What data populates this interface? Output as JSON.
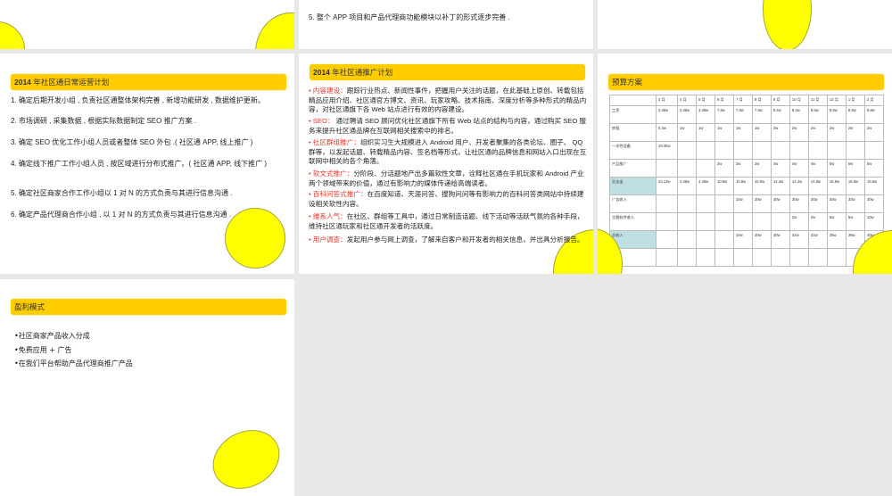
{
  "slides": {
    "top_mid": {
      "item5": "5.  整个 APP 项目和产品代理商功能模块以补丁的形式逐步完善 ."
    },
    "ops_plan": {
      "title_year": "2014",
      "title": " 年社区通日常运营计划",
      "items": [
        "1.  确定后期开发小组 , 负责社区通整体架构完善 , 新增功能研发 , 数据维护更新。",
        "2.  市场调研 , 采集数据 , 根据实际数据制定 SEO 推广方案 .",
        "3.  确定 SEO 优化工作小组人员或者整体 SEO 外包 .(  社区通 APP, 线上推广  )",
        "4.  确定线下推广工作小组人员 , 按区域进行分布式推广。(  社区通 APP, 线下推广  )",
        "5.  确定社区商家合作工作小组以 1 对 N 的方式负责与其进行信息沟通 .",
        "6.  确定产品代理商合作小组 , 以 1 对 N 的方式负责与其进行信息沟通 ."
      ]
    },
    "promo_plan": {
      "title_year": "2014",
      "title": " 年社区通推广计划",
      "items": [
        {
          "key": "内容建设：",
          "text": "跟踪行业热点、新闻性事件，把握用户关注的话题，在此基础上原创、转载包括精品应用介绍、社区通官方博文、资讯、玩家攻略、技术指南、深度分析等多种形式的精品内容，对社区通旗下各 Web 站点进行有效的内容建设。"
        },
        {
          "key": "SEO：",
          "text": " 通过聘请 SEO 顾问优化社区通旗下所有 Web 站点的结构与内容，通过购买 SEO 服务来提升社区通品牌在互联网相关搜索中的排名。"
        },
        {
          "key": "社区群组推广：",
          "text": "组织实习生大规模进入 Android 用户、开发者聚集的各类论坛、圈子、 QQ 群等，以发起话题、转载精品内容、签名档等形式，让社区通的品牌信息和网站入口出现在互联网中相关的各个角落。"
        },
        {
          "key": "软文式推广：",
          "text": "分阶段、分话题地产出多篇软性文章，诠释社区通在手机玩家和 Android 产业两个领域带来的价值，通过有影响力的媒体传递给高端读者。"
        },
        {
          "key": "百科问答式推广：",
          "text": "在百度知道、天涯问答、搜狗问问等有影响力的百科问答类网站中持续建设相关软性内容。"
        },
        {
          "key": "维系人气：",
          "text": "在社区、群组等工具中，通过日常制造话题、线下活动等活跃气氛的各种手段，维持社区通玩家和社区通开发者的活跃度。"
        },
        {
          "key": "用户调查：",
          "text": "发起用户参与网上调查，了解来自客户和开发者的相关信息，并出具分析报告。"
        }
      ]
    },
    "budget": {
      "title": "预算方案",
      "headers": [
        "",
        "3 月",
        "4 月",
        "5 月",
        "6 月",
        "7 月",
        "8 月",
        "9 月",
        "10 月",
        "11 月",
        "12 月",
        "1 月",
        "2 月"
      ],
      "rows": [
        {
          "label": "工资",
          "highlight": false,
          "values": [
            "3.48w",
            "3.48w",
            "3.48w",
            "7.8w",
            "7.8w",
            "7.8w",
            "8.4w",
            "8.4w",
            "8.8w",
            "8.9w",
            "8.9w",
            "8.9w"
          ]
        },
        {
          "label": "房租",
          "highlight": false,
          "values": [
            "0.3w",
            "1w",
            "1w",
            "1w",
            "1w",
            "1w",
            "2w",
            "2w",
            "2w",
            "2w",
            "2w",
            "2w"
          ]
        },
        {
          "label": "一次性设备",
          "highlight": false,
          "values": [
            "19.35w",
            "",
            "",
            "",
            "",
            "",
            "",
            "",
            "",
            "",
            "",
            ""
          ]
        },
        {
          "label": "产品推广",
          "highlight": false,
          "values": [
            "",
            "",
            "",
            "2w",
            "2w",
            "2w",
            "4w",
            "4w",
            "4w",
            "5w",
            "5w",
            "5w"
          ]
        },
        {
          "label": "总支出",
          "highlight": true,
          "values": [
            "23.13w",
            "4.48w",
            "4.48w",
            "10.8w",
            "10.8w",
            "10.8w",
            "14.4w",
            "14.4w",
            "14.8w",
            "15.9w",
            "15.9w",
            "15.9w"
          ]
        },
        {
          "label": "广告收入",
          "highlight": false,
          "values": [
            "",
            "",
            "",
            "",
            "10w",
            "20w",
            "30w",
            "30w",
            "30w",
            "30w",
            "30w",
            "30w"
          ]
        },
        {
          "label": "主题软件收入",
          "highlight": false,
          "values": [
            "",
            "",
            "",
            "",
            "",
            "",
            "",
            "2w",
            "2w",
            "5w",
            "5w",
            "10w"
          ]
        },
        {
          "label": "总收入",
          "highlight": true,
          "values": [
            "",
            "",
            "",
            "",
            "10w",
            "20w",
            "30w",
            "32w",
            "32w",
            "35w",
            "35w",
            "40w"
          ]
        },
        {
          "label": "",
          "highlight": false,
          "values": [
            "",
            "",
            "",
            "",
            "",
            "",
            "",
            "",
            "",
            "",
            "",
            ""
          ]
        }
      ]
    },
    "profit": {
      "title": "盈利模式",
      "items": [
        "•社区商家产品收入分成",
        "•免费应用 + 广告",
        "•在我们平台帮助产品代理商推广产品"
      ]
    }
  }
}
